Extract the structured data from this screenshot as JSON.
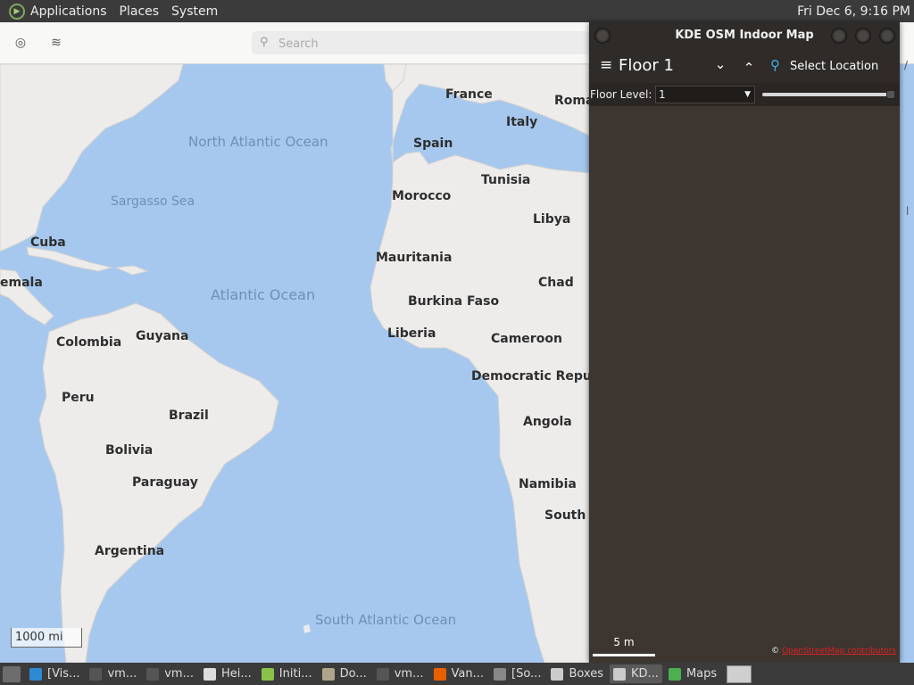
{
  "top_panel": {
    "menus": [
      "Applications",
      "Places",
      "System"
    ],
    "clock": "Fri Dec  6,  9:16 PM"
  },
  "maps_app": {
    "search_placeholder": "Search",
    "scale_label": "1000 mi",
    "countries": [
      "France",
      "Roma",
      "Italy",
      "Spain",
      "Tunisia",
      "Morocco",
      "Libya",
      "Cuba",
      "emala",
      "Mauritania",
      "Chad",
      "Burkina Faso",
      "Liberia",
      "Cameroon",
      "Colombia",
      "Guyana",
      "Peru",
      "Brazil",
      "Democratic Republ",
      "Angola",
      "Bolivia",
      "Paraguay",
      "Namibia",
      "South A",
      "Argentina"
    ],
    "oceans": [
      "North Atlantic Ocean",
      "Sargasso Sea",
      "Atlantic Ocean",
      "South Atlantic Ocean"
    ]
  },
  "indoor_window": {
    "title": "KDE OSM Indoor Map",
    "floor_title": "Floor 1",
    "select_location_label": "Select Location",
    "floor_level_label": "Floor Level:",
    "floor_level_value": "1",
    "scale_label": "5 m",
    "attribution_symbol": "©",
    "attribution_link": "OpenStreetMap contributors"
  },
  "taskbar": {
    "items": [
      {
        "label": "[Vis...",
        "icon_color": "#2f8ad6",
        "icon": "vscode-icon"
      },
      {
        "label": "vm...",
        "icon_color": "#555555",
        "icon": "terminal-icon"
      },
      {
        "label": "vm...",
        "icon_color": "#555555",
        "icon": "terminal-icon"
      },
      {
        "label": "Hei...",
        "icon_color": "#dddddd",
        "icon": "document-icon"
      },
      {
        "label": "Initi...",
        "icon_color": "#8bc34a",
        "icon": "app-icon"
      },
      {
        "label": "Do...",
        "icon_color": "#b0a58a",
        "icon": "folder-icon"
      },
      {
        "label": "vm...",
        "icon_color": "#555555",
        "icon": "terminal-icon"
      },
      {
        "label": "Van...",
        "icon_color": "#e66000",
        "icon": "firefox-icon"
      },
      {
        "label": "[So...",
        "icon_color": "#888888",
        "icon": "camera-icon"
      },
      {
        "label": "Boxes",
        "icon_color": "#cccccc",
        "icon": "boxes-icon"
      },
      {
        "label": "KD...",
        "icon_color": "#cccccc",
        "icon": "home-icon",
        "active": true
      },
      {
        "label": "Maps",
        "icon_color": "#4caf50",
        "icon": "maps-icon"
      }
    ]
  },
  "colors": {
    "ocean": "#a6c8ee",
    "land": "#eeeceb",
    "indoor_bg": "#3c3530",
    "panel": "#3b3b3b",
    "accent": "#3daee9"
  }
}
